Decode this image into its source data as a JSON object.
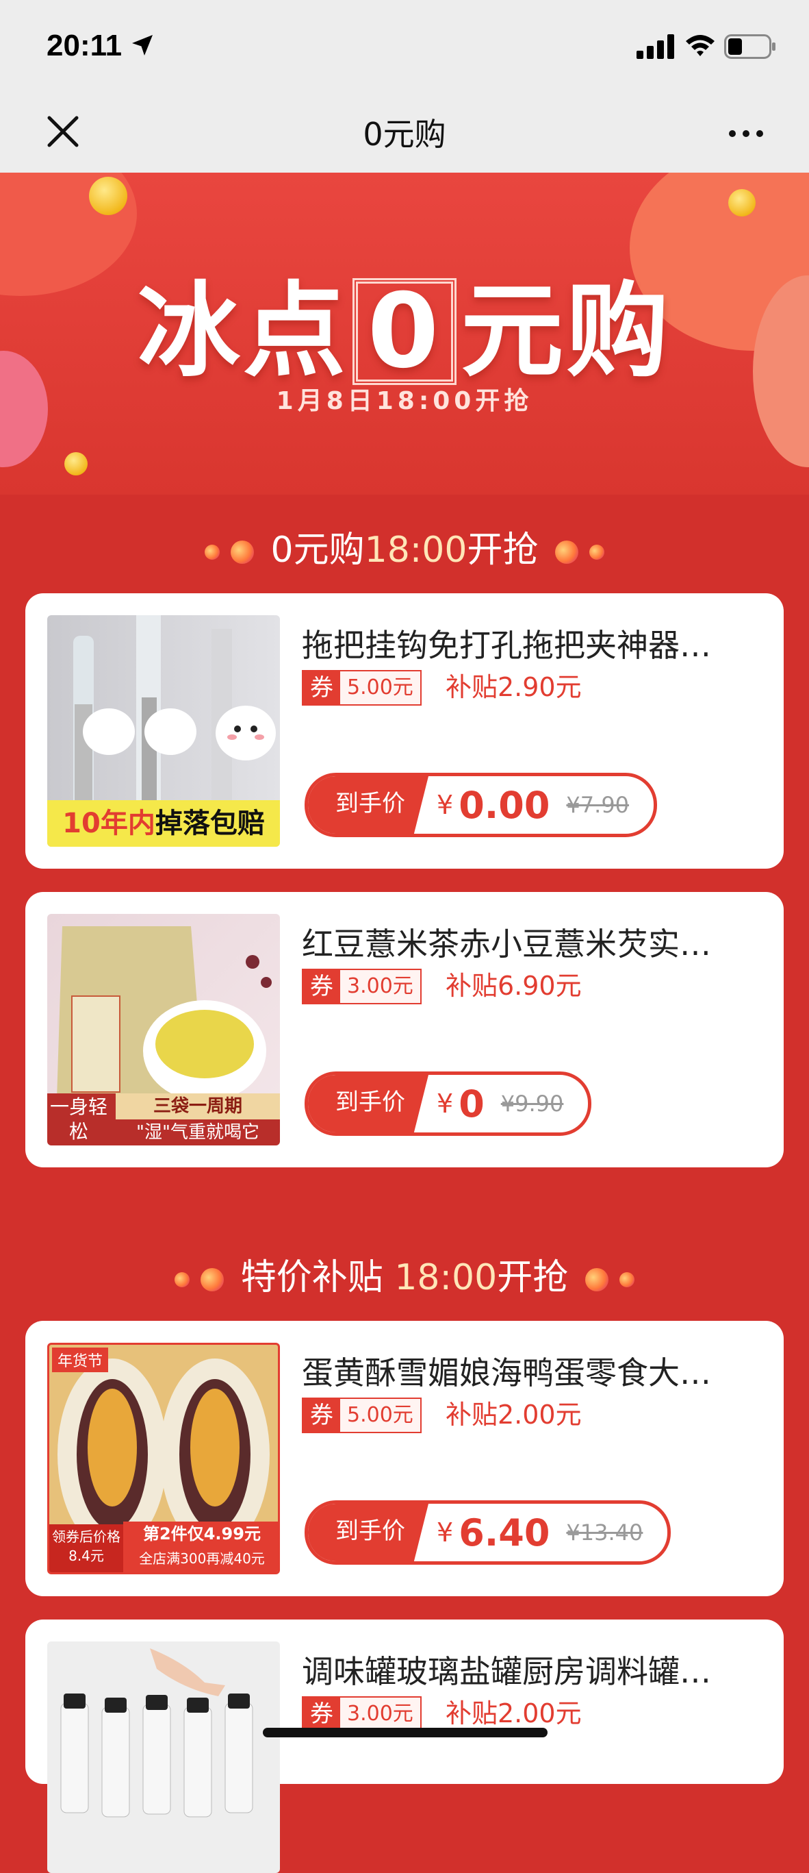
{
  "status_bar": {
    "time": "20:11"
  },
  "nav": {
    "title": "0元购"
  },
  "banner": {
    "title_before": "冰点",
    "title_zero": "0",
    "title_after": "元购",
    "date": "1月8日18:00开抢"
  },
  "sections": [
    {
      "prefix": "0元购",
      "time": "18:00",
      "suffix": "开抢"
    },
    {
      "prefix": "特价补贴 ",
      "time": "18:00",
      "suffix": "开抢"
    }
  ],
  "products": [
    {
      "title": "拖把挂钩免打孔拖把夹神器…",
      "coupon_tag": "券",
      "coupon_amount": "5.00元",
      "subsidy": "补贴2.90元",
      "price_label": "到手价",
      "currency": "¥",
      "price": "0.00",
      "original_price": "¥7.90",
      "thumb_caption_a": "10年内",
      "thumb_caption_b": "掉落包赔"
    },
    {
      "title": "红豆薏米茶赤小豆薏米芡实…",
      "coupon_tag": "券",
      "coupon_amount": "3.00元",
      "subsidy": "补贴6.90元",
      "price_label": "到手价",
      "currency": "¥",
      "price": "0",
      "original_price": "¥9.90",
      "thumb_caption_a": "一身轻松",
      "thumb_caption_b": "三袋一周期",
      "thumb_caption_c": "\"湿\"气重就喝它"
    },
    {
      "title": "蛋黄酥雪媚娘海鸭蛋零食大…",
      "coupon_tag": "券",
      "coupon_amount": "5.00元",
      "subsidy": "补贴2.00元",
      "price_label": "到手价",
      "currency": "¥",
      "price": "6.40",
      "original_price": "¥13.40",
      "thumb_caption_a": "第2件仅4.99元",
      "thumb_caption_b": "全店满300再减40元",
      "thumb_caption_c": "领券后价格 8.4元",
      "thumb_caption_d": "年货节"
    },
    {
      "title": "调味罐玻璃盐罐厨房调料罐…",
      "coupon_tag": "券",
      "coupon_amount": "3.00元",
      "subsidy": "补贴2.00元"
    }
  ]
}
